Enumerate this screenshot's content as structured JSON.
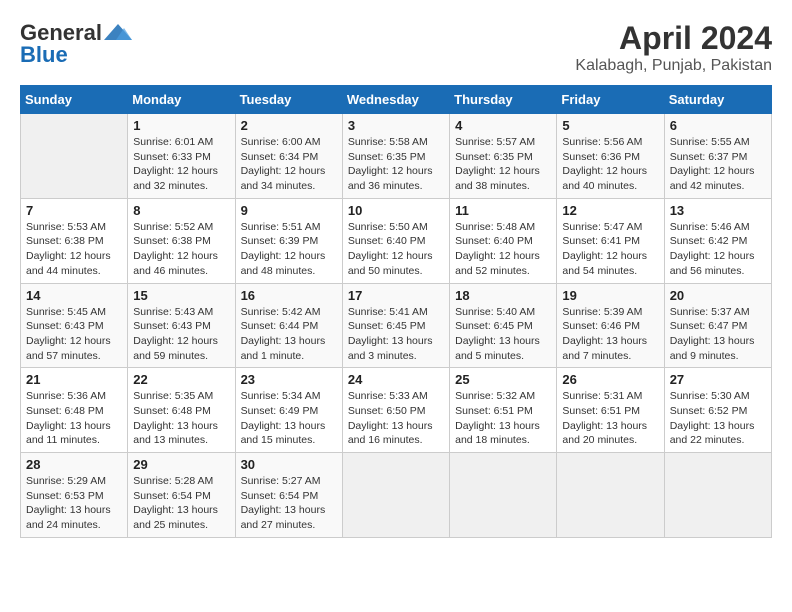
{
  "header": {
    "logo_line1": "General",
    "logo_line2": "Blue",
    "title": "April 2024",
    "subtitle": "Kalabagh, Punjab, Pakistan"
  },
  "columns": [
    "Sunday",
    "Monday",
    "Tuesday",
    "Wednesday",
    "Thursday",
    "Friday",
    "Saturday"
  ],
  "weeks": [
    {
      "cells": [
        {
          "empty": true
        },
        {
          "day": "1",
          "sunrise": "6:01 AM",
          "sunset": "6:33 PM",
          "daylight": "12 hours and 32 minutes."
        },
        {
          "day": "2",
          "sunrise": "6:00 AM",
          "sunset": "6:34 PM",
          "daylight": "12 hours and 34 minutes."
        },
        {
          "day": "3",
          "sunrise": "5:58 AM",
          "sunset": "6:35 PM",
          "daylight": "12 hours and 36 minutes."
        },
        {
          "day": "4",
          "sunrise": "5:57 AM",
          "sunset": "6:35 PM",
          "daylight": "12 hours and 38 minutes."
        },
        {
          "day": "5",
          "sunrise": "5:56 AM",
          "sunset": "6:36 PM",
          "daylight": "12 hours and 40 minutes."
        },
        {
          "day": "6",
          "sunrise": "5:55 AM",
          "sunset": "6:37 PM",
          "daylight": "12 hours and 42 minutes."
        }
      ]
    },
    {
      "cells": [
        {
          "day": "7",
          "sunrise": "5:53 AM",
          "sunset": "6:38 PM",
          "daylight": "12 hours and 44 minutes."
        },
        {
          "day": "8",
          "sunrise": "5:52 AM",
          "sunset": "6:38 PM",
          "daylight": "12 hours and 46 minutes."
        },
        {
          "day": "9",
          "sunrise": "5:51 AM",
          "sunset": "6:39 PM",
          "daylight": "12 hours and 48 minutes."
        },
        {
          "day": "10",
          "sunrise": "5:50 AM",
          "sunset": "6:40 PM",
          "daylight": "12 hours and 50 minutes."
        },
        {
          "day": "11",
          "sunrise": "5:48 AM",
          "sunset": "6:40 PM",
          "daylight": "12 hours and 52 minutes."
        },
        {
          "day": "12",
          "sunrise": "5:47 AM",
          "sunset": "6:41 PM",
          "daylight": "12 hours and 54 minutes."
        },
        {
          "day": "13",
          "sunrise": "5:46 AM",
          "sunset": "6:42 PM",
          "daylight": "12 hours and 56 minutes."
        }
      ]
    },
    {
      "cells": [
        {
          "day": "14",
          "sunrise": "5:45 AM",
          "sunset": "6:43 PM",
          "daylight": "12 hours and 57 minutes."
        },
        {
          "day": "15",
          "sunrise": "5:43 AM",
          "sunset": "6:43 PM",
          "daylight": "12 hours and 59 minutes."
        },
        {
          "day": "16",
          "sunrise": "5:42 AM",
          "sunset": "6:44 PM",
          "daylight": "13 hours and 1 minute."
        },
        {
          "day": "17",
          "sunrise": "5:41 AM",
          "sunset": "6:45 PM",
          "daylight": "13 hours and 3 minutes."
        },
        {
          "day": "18",
          "sunrise": "5:40 AM",
          "sunset": "6:45 PM",
          "daylight": "13 hours and 5 minutes."
        },
        {
          "day": "19",
          "sunrise": "5:39 AM",
          "sunset": "6:46 PM",
          "daylight": "13 hours and 7 minutes."
        },
        {
          "day": "20",
          "sunrise": "5:37 AM",
          "sunset": "6:47 PM",
          "daylight": "13 hours and 9 minutes."
        }
      ]
    },
    {
      "cells": [
        {
          "day": "21",
          "sunrise": "5:36 AM",
          "sunset": "6:48 PM",
          "daylight": "13 hours and 11 minutes."
        },
        {
          "day": "22",
          "sunrise": "5:35 AM",
          "sunset": "6:48 PM",
          "daylight": "13 hours and 13 minutes."
        },
        {
          "day": "23",
          "sunrise": "5:34 AM",
          "sunset": "6:49 PM",
          "daylight": "13 hours and 15 minutes."
        },
        {
          "day": "24",
          "sunrise": "5:33 AM",
          "sunset": "6:50 PM",
          "daylight": "13 hours and 16 minutes."
        },
        {
          "day": "25",
          "sunrise": "5:32 AM",
          "sunset": "6:51 PM",
          "daylight": "13 hours and 18 minutes."
        },
        {
          "day": "26",
          "sunrise": "5:31 AM",
          "sunset": "6:51 PM",
          "daylight": "13 hours and 20 minutes."
        },
        {
          "day": "27",
          "sunrise": "5:30 AM",
          "sunset": "6:52 PM",
          "daylight": "13 hours and 22 minutes."
        }
      ]
    },
    {
      "cells": [
        {
          "day": "28",
          "sunrise": "5:29 AM",
          "sunset": "6:53 PM",
          "daylight": "13 hours and 24 minutes."
        },
        {
          "day": "29",
          "sunrise": "5:28 AM",
          "sunset": "6:54 PM",
          "daylight": "13 hours and 25 minutes."
        },
        {
          "day": "30",
          "sunrise": "5:27 AM",
          "sunset": "6:54 PM",
          "daylight": "13 hours and 27 minutes."
        },
        {
          "empty": true
        },
        {
          "empty": true
        },
        {
          "empty": true
        },
        {
          "empty": true
        }
      ]
    }
  ],
  "labels": {
    "sunrise_prefix": "Sunrise: ",
    "sunset_prefix": "Sunset: ",
    "daylight_prefix": "Daylight: "
  }
}
